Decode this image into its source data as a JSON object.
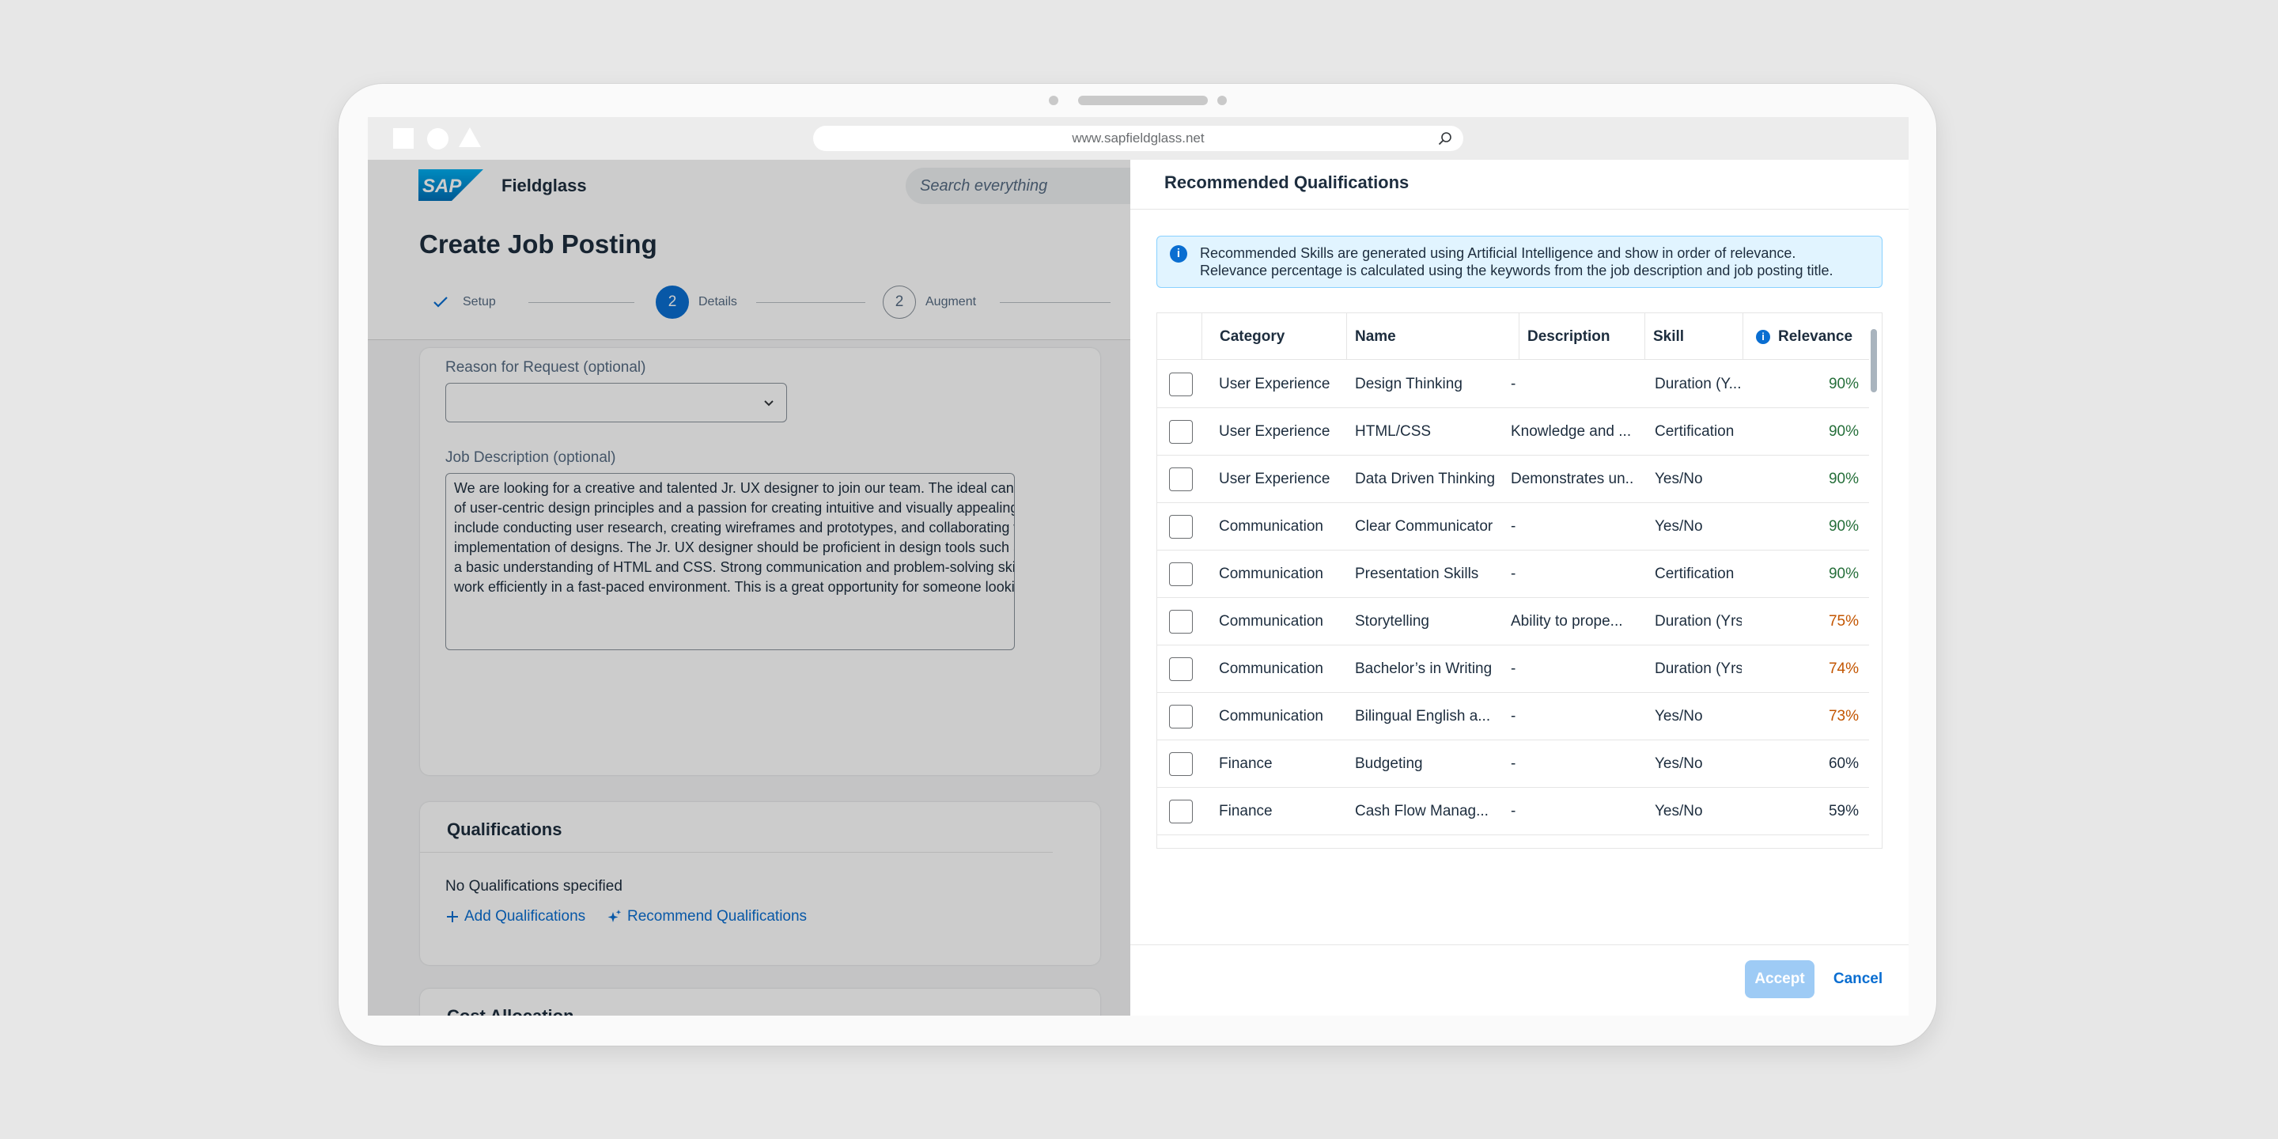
{
  "browser": {
    "url": "www.sapfieldglass.net"
  },
  "shell": {
    "logo_text": "SAP",
    "app_name": "Fieldglass",
    "search_placeholder": "Search everything"
  },
  "page": {
    "title": "Create Job Posting",
    "steps": [
      {
        "label": "Setup",
        "state": "done"
      },
      {
        "number": "2",
        "label": "Details",
        "state": "active"
      },
      {
        "number": "2",
        "label": "Augment",
        "state": "pending"
      }
    ]
  },
  "form": {
    "reason_label": "Reason for Request (optional)",
    "reason_value": "",
    "description_label": "Job Description (optional)",
    "description_lines": [
      "We are looking for a creative and talented Jr. UX designer to join our team. The ideal candidate will hav",
      "of user-centric design principles and a passion for creating intuitive and visually appealing user experie",
      "include conducting user research, creating wireframes and prototypes, and collaborating with develope",
      "implementation of designs. The Jr. UX designer should be proficient in design tools such as Sketch, Fig",
      "a basic understanding of HTML and CSS. Strong communication and problem-solving skills are essenti",
      "work efficiently in a fast-paced environment. This is a great opportunity for someone looking to grow th"
    ]
  },
  "qualifications": {
    "title": "Qualifications",
    "empty_text": "No Qualifications specified",
    "add_link": "Add Qualifications",
    "recommend_link": "Recommend Qualifications"
  },
  "cost_allocation": {
    "title": "Cost Allocation"
  },
  "dialog": {
    "title": "Recommended Qualifications",
    "info_line1": "Recommended Skills are generated using Artificial Intelligence and show in order of relevance.",
    "info_line2": "Relevance percentage is calculated using the keywords from the job description and job posting title.",
    "columns": {
      "category": "Category",
      "name": "Name",
      "description": "Description",
      "skill": "Skill",
      "relevance": "Relevance"
    },
    "rows": [
      {
        "category": "User Experience",
        "name": "Design Thinking",
        "description": "-",
        "skill": "Duration (Y...",
        "relevance": "90%",
        "color": "#256f3a"
      },
      {
        "category": "User Experience",
        "name": "HTML/CSS",
        "description": "Knowledge and ...",
        "skill": "Certification",
        "relevance": "90%",
        "color": "#256f3a"
      },
      {
        "category": "User Experience",
        "name": "Data Driven Thinking",
        "description": "Demonstrates un..",
        "skill": "Yes/No",
        "relevance": "90%",
        "color": "#256f3a"
      },
      {
        "category": "Communication",
        "name": "Clear Communicator",
        "description": "-",
        "skill": "Yes/No",
        "relevance": "90%",
        "color": "#256f3a"
      },
      {
        "category": "Communication",
        "name": "Presentation Skills",
        "description": "-",
        "skill": "Certification",
        "relevance": "90%",
        "color": "#256f3a"
      },
      {
        "category": "Communication",
        "name": "Storytelling",
        "description": "Ability to prope...",
        "skill": "Duration (Yrs)",
        "relevance": "75%",
        "color": "#c35500"
      },
      {
        "category": "Communication",
        "name": "Bachelor’s in Writing",
        "description": "-",
        "skill": "Duration (Yrs)",
        "relevance": "74%",
        "color": "#c35500"
      },
      {
        "category": "Communication",
        "name": "Bilingual English a...",
        "description": "-",
        "skill": "Yes/No",
        "relevance": "73%",
        "color": "#c35500"
      },
      {
        "category": "Finance",
        "name": "Budgeting",
        "description": "-",
        "skill": "Yes/No",
        "relevance": "60%",
        "color": "#1d2d3e"
      },
      {
        "category": "Finance",
        "name": "Cash Flow Manag...",
        "description": "-",
        "skill": "Yes/No",
        "relevance": "59%",
        "color": "#1d2d3e"
      }
    ],
    "accept_label": "Accept",
    "cancel_label": "Cancel"
  },
  "icons": {
    "info": "information-icon",
    "search": "search-icon",
    "chevron": "chevron-down-icon",
    "check": "checkmark-icon",
    "add": "add-icon",
    "sparkle": "ai-sparkle-icon"
  }
}
